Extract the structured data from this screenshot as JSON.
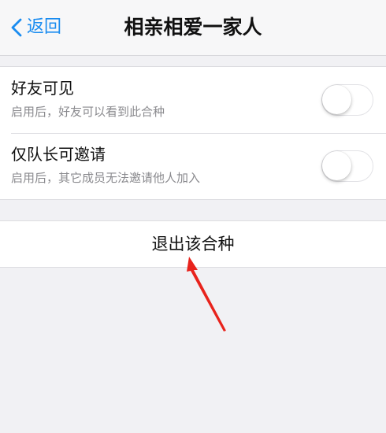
{
  "navbar": {
    "back_label": "返回",
    "title": "相亲相爱一家人",
    "back_icon": "chevron-left-icon"
  },
  "settings": {
    "items": [
      {
        "title": "好友可见",
        "subtitle": "启用后，好友可以看到此合种",
        "toggle_on": false
      },
      {
        "title": "仅队长可邀请",
        "subtitle": "启用后，其它成员无法邀请他人加入",
        "toggle_on": false
      }
    ]
  },
  "actions": {
    "exit_label": "退出该合种"
  },
  "colors": {
    "accent": "#1a8cf0",
    "annotation_arrow": "#e8231c",
    "background": "#f1f1f4"
  }
}
